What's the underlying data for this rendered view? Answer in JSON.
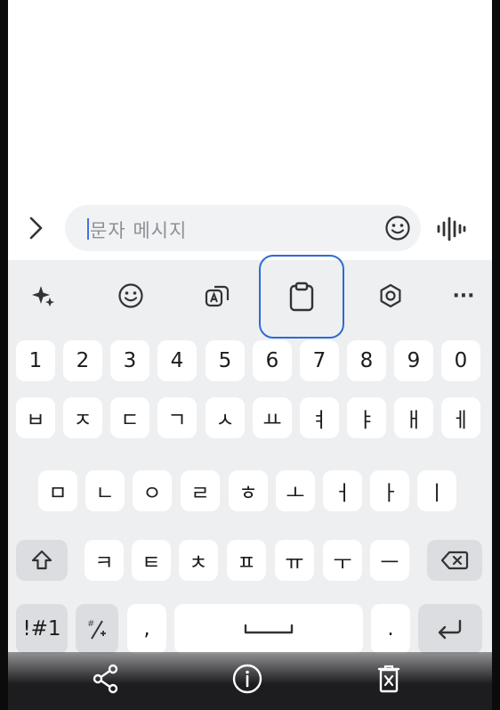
{
  "compose": {
    "placeholder": "문자 메시지",
    "icons": [
      "chevron-right-icon",
      "emoji-icon",
      "voice-wave-icon"
    ]
  },
  "toolbar": {
    "icons": [
      "sparkle-icon",
      "emoji-icon",
      "translate-icon",
      "clipboard-icon",
      "settings-icon",
      "more-icon"
    ],
    "more_label": "···",
    "highlighted": "clipboard-icon",
    "highlight_color": "#2d6bd6"
  },
  "keyboard": {
    "numbers": [
      "1",
      "2",
      "3",
      "4",
      "5",
      "6",
      "7",
      "8",
      "9",
      "0"
    ],
    "row1": [
      "ㅂ",
      "ㅈ",
      "ㄷ",
      "ㄱ",
      "ㅅ",
      "ㅛ",
      "ㅕ",
      "ㅑ",
      "ㅐ",
      "ㅔ"
    ],
    "row2": [
      "ㅁ",
      "ㄴ",
      "ㅇ",
      "ㄹ",
      "ㅎ",
      "ㅗ",
      "ㅓ",
      "ㅏ",
      "ㅣ"
    ],
    "row3": [
      "ㅋ",
      "ㅌ",
      "ㅊ",
      "ㅍ",
      "ㅠ",
      "ㅜ",
      "ㅡ"
    ],
    "symbols_label": "!#1",
    "comma_label": ",",
    "period_label": "."
  },
  "bottom_bar": {
    "icons": [
      "share-icon",
      "info-icon",
      "delete-icon"
    ]
  }
}
